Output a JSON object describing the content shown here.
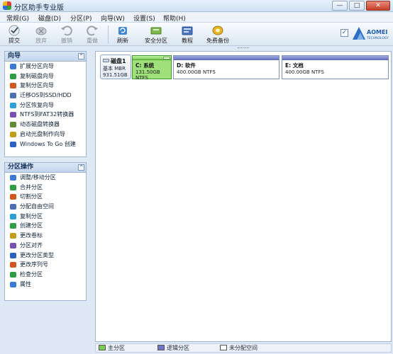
{
  "window": {
    "title": "分区助手专业版",
    "controls": {
      "minimize": "—",
      "maximize": "□",
      "close": "✕"
    }
  },
  "menu": [
    {
      "label": "常规(G)"
    },
    {
      "label": "磁盘(D)"
    },
    {
      "label": "分区(P)"
    },
    {
      "label": "向导(W)"
    },
    {
      "label": "设置(S)"
    },
    {
      "label": "帮助(H)"
    }
  ],
  "toolbar": {
    "buttons": [
      {
        "label": "提交",
        "icon": "apply-check-icon",
        "enabled": true
      },
      {
        "label": "放弃",
        "icon": "discard-icon",
        "enabled": false
      },
      {
        "label": "撤销",
        "icon": "undo-icon",
        "enabled": false
      },
      {
        "label": "重做",
        "icon": "redo-icon",
        "enabled": false
      },
      {
        "label": "刷新",
        "icon": "refresh-icon",
        "enabled": true
      },
      {
        "label": "安全分区",
        "icon": "safe-partition-icon",
        "enabled": true
      },
      {
        "label": "教程",
        "icon": "tutorial-icon",
        "enabled": true
      },
      {
        "label": "免费备份",
        "icon": "free-backup-icon",
        "enabled": true
      }
    ],
    "brand_text": "AOMEI",
    "brand_sub": "TECHNOLOGY"
  },
  "wizard_panel": {
    "title": "向导",
    "items": [
      {
        "label": "扩展分区向导",
        "color": "#3a7bd5"
      },
      {
        "label": "复制磁盘向导",
        "color": "#2e9e44"
      },
      {
        "label": "复制分区向导",
        "color": "#d1571f"
      },
      {
        "label": "迁移OS到SSD/HDD",
        "color": "#4a6fb5"
      },
      {
        "label": "分区恢复向导",
        "color": "#2c9fd6"
      },
      {
        "label": "NTFS到FAT32转换器",
        "color": "#7a4fb5"
      },
      {
        "label": "动态磁盘转换器",
        "color": "#5a8f2b"
      },
      {
        "label": "启动光盘制作向导",
        "color": "#c59b1a"
      },
      {
        "label": "Windows To Go 创建",
        "color": "#2a62c4"
      }
    ]
  },
  "ops_panel": {
    "title": "分区操作",
    "items": [
      {
        "label": "调整/移动分区",
        "color": "#3a7bd5"
      },
      {
        "label": "合并分区",
        "color": "#2e9e44"
      },
      {
        "label": "切割分区",
        "color": "#d1571f"
      },
      {
        "label": "分配自由空间",
        "color": "#4a6fb5"
      },
      {
        "label": "复制分区",
        "color": "#2c9fd6"
      },
      {
        "label": "创建分区",
        "color": "#2e9e44"
      },
      {
        "label": "更改卷标",
        "color": "#c59b1a"
      },
      {
        "label": "分区对齐",
        "color": "#7a4fb5"
      },
      {
        "label": "更改分区类型",
        "color": "#2a62c4"
      },
      {
        "label": "更改序列号",
        "color": "#d1571f"
      },
      {
        "label": "检查分区",
        "color": "#2e9e44"
      },
      {
        "label": "属性",
        "color": "#3a7bd5"
      }
    ]
  },
  "disk": {
    "name": "磁盘1",
    "type": "基本 MBR",
    "size": "931.51GB",
    "partitions": [
      {
        "name": "C: 系统",
        "capacity": "131.50GB NTFS",
        "selected": true
      },
      {
        "name": "D: 软件",
        "capacity": "400.00GB NTFS",
        "selected": false
      },
      {
        "name": "E: 文档",
        "capacity": "400.00GB NTFS",
        "selected": false
      }
    ]
  },
  "legend": {
    "primary": "主分区",
    "logical": "逻辑分区",
    "unallocated": "未分配空间",
    "colors": {
      "primary": "#7ccd55",
      "logical": "#6c78c7",
      "unallocated": "#ffffff"
    }
  }
}
